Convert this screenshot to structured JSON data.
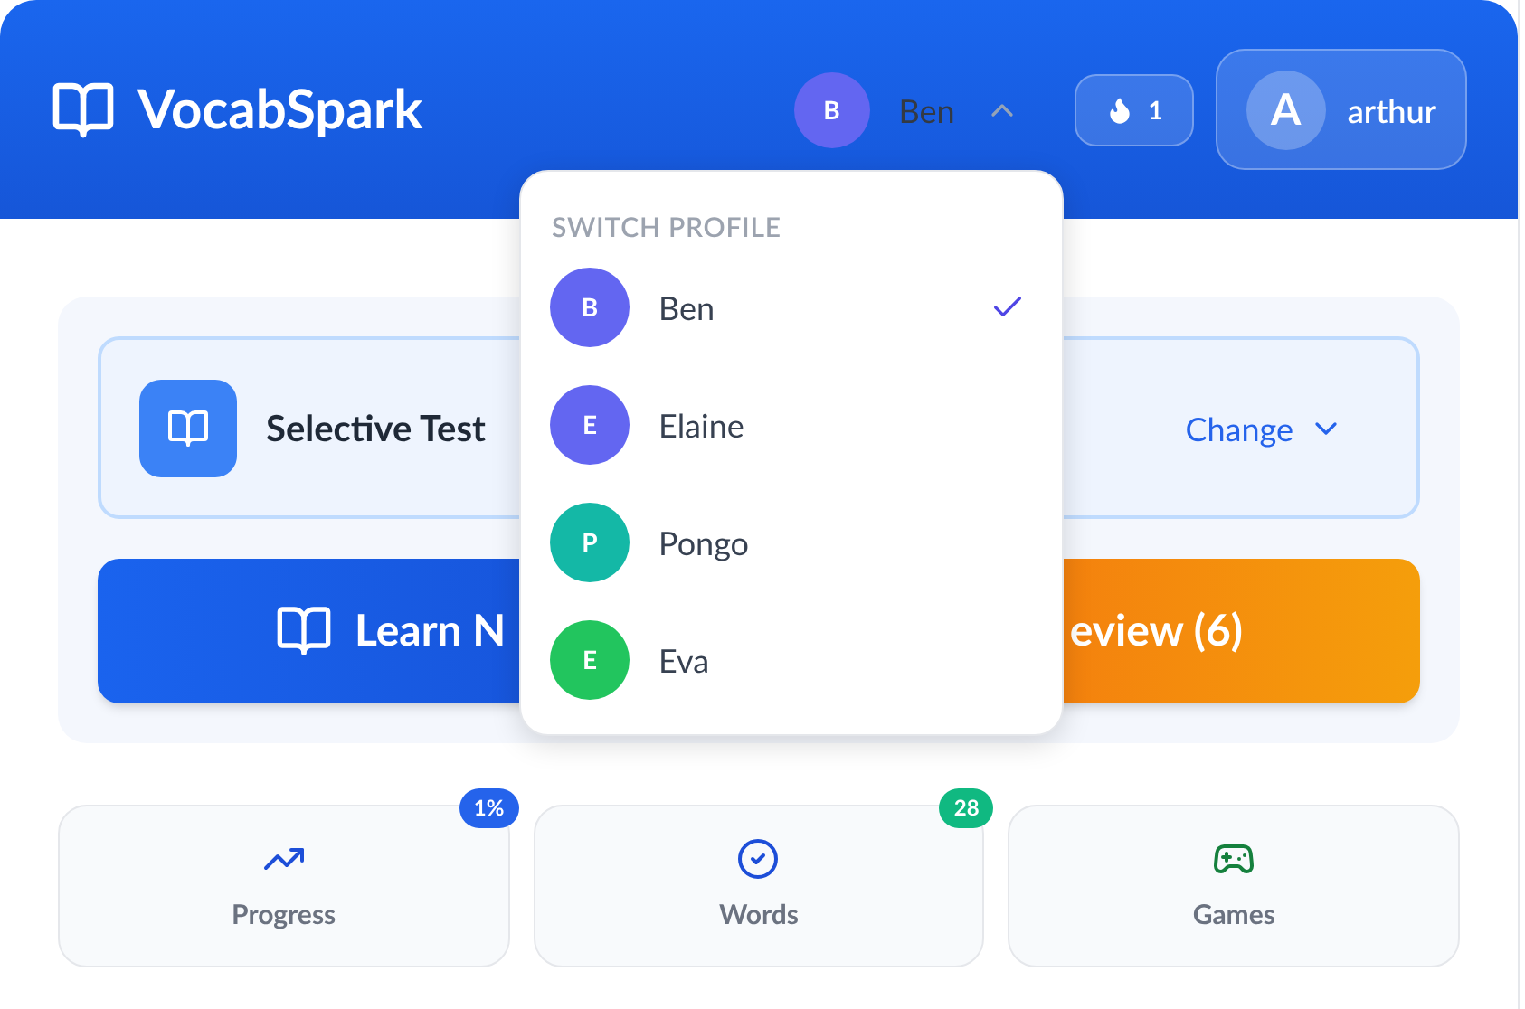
{
  "header": {
    "brand": "VocabSpark",
    "current_profile": {
      "initial": "B",
      "name": "Ben",
      "color": "#6366f1",
      "menu_open": true
    },
    "streak": "1",
    "user": {
      "initial": "A",
      "name": "arthur"
    }
  },
  "profile_menu": {
    "title": "SWITCH PROFILE",
    "profiles": [
      {
        "initial": "B",
        "name": "Ben",
        "color": "#6366f1",
        "selected": true
      },
      {
        "initial": "E",
        "name": "Elaine",
        "color": "#6366f1",
        "selected": false
      },
      {
        "initial": "P",
        "name": "Pongo",
        "color": "#14b8a6",
        "selected": false
      },
      {
        "initial": "E",
        "name": "Eva",
        "color": "#22c55e",
        "selected": false
      }
    ]
  },
  "course": {
    "title": "Selective Test",
    "action": "Change"
  },
  "actions": [
    {
      "kind": "learn",
      "label": "Learn N"
    },
    {
      "kind": "review",
      "label": "eview (6)"
    }
  ],
  "tiles": [
    {
      "kind": "progress",
      "label": "Progress",
      "badge": "1%",
      "color": "#2563eb"
    },
    {
      "kind": "words",
      "label": "Words",
      "badge": "28",
      "color": "#10b981"
    },
    {
      "kind": "games",
      "label": "Games"
    }
  ]
}
